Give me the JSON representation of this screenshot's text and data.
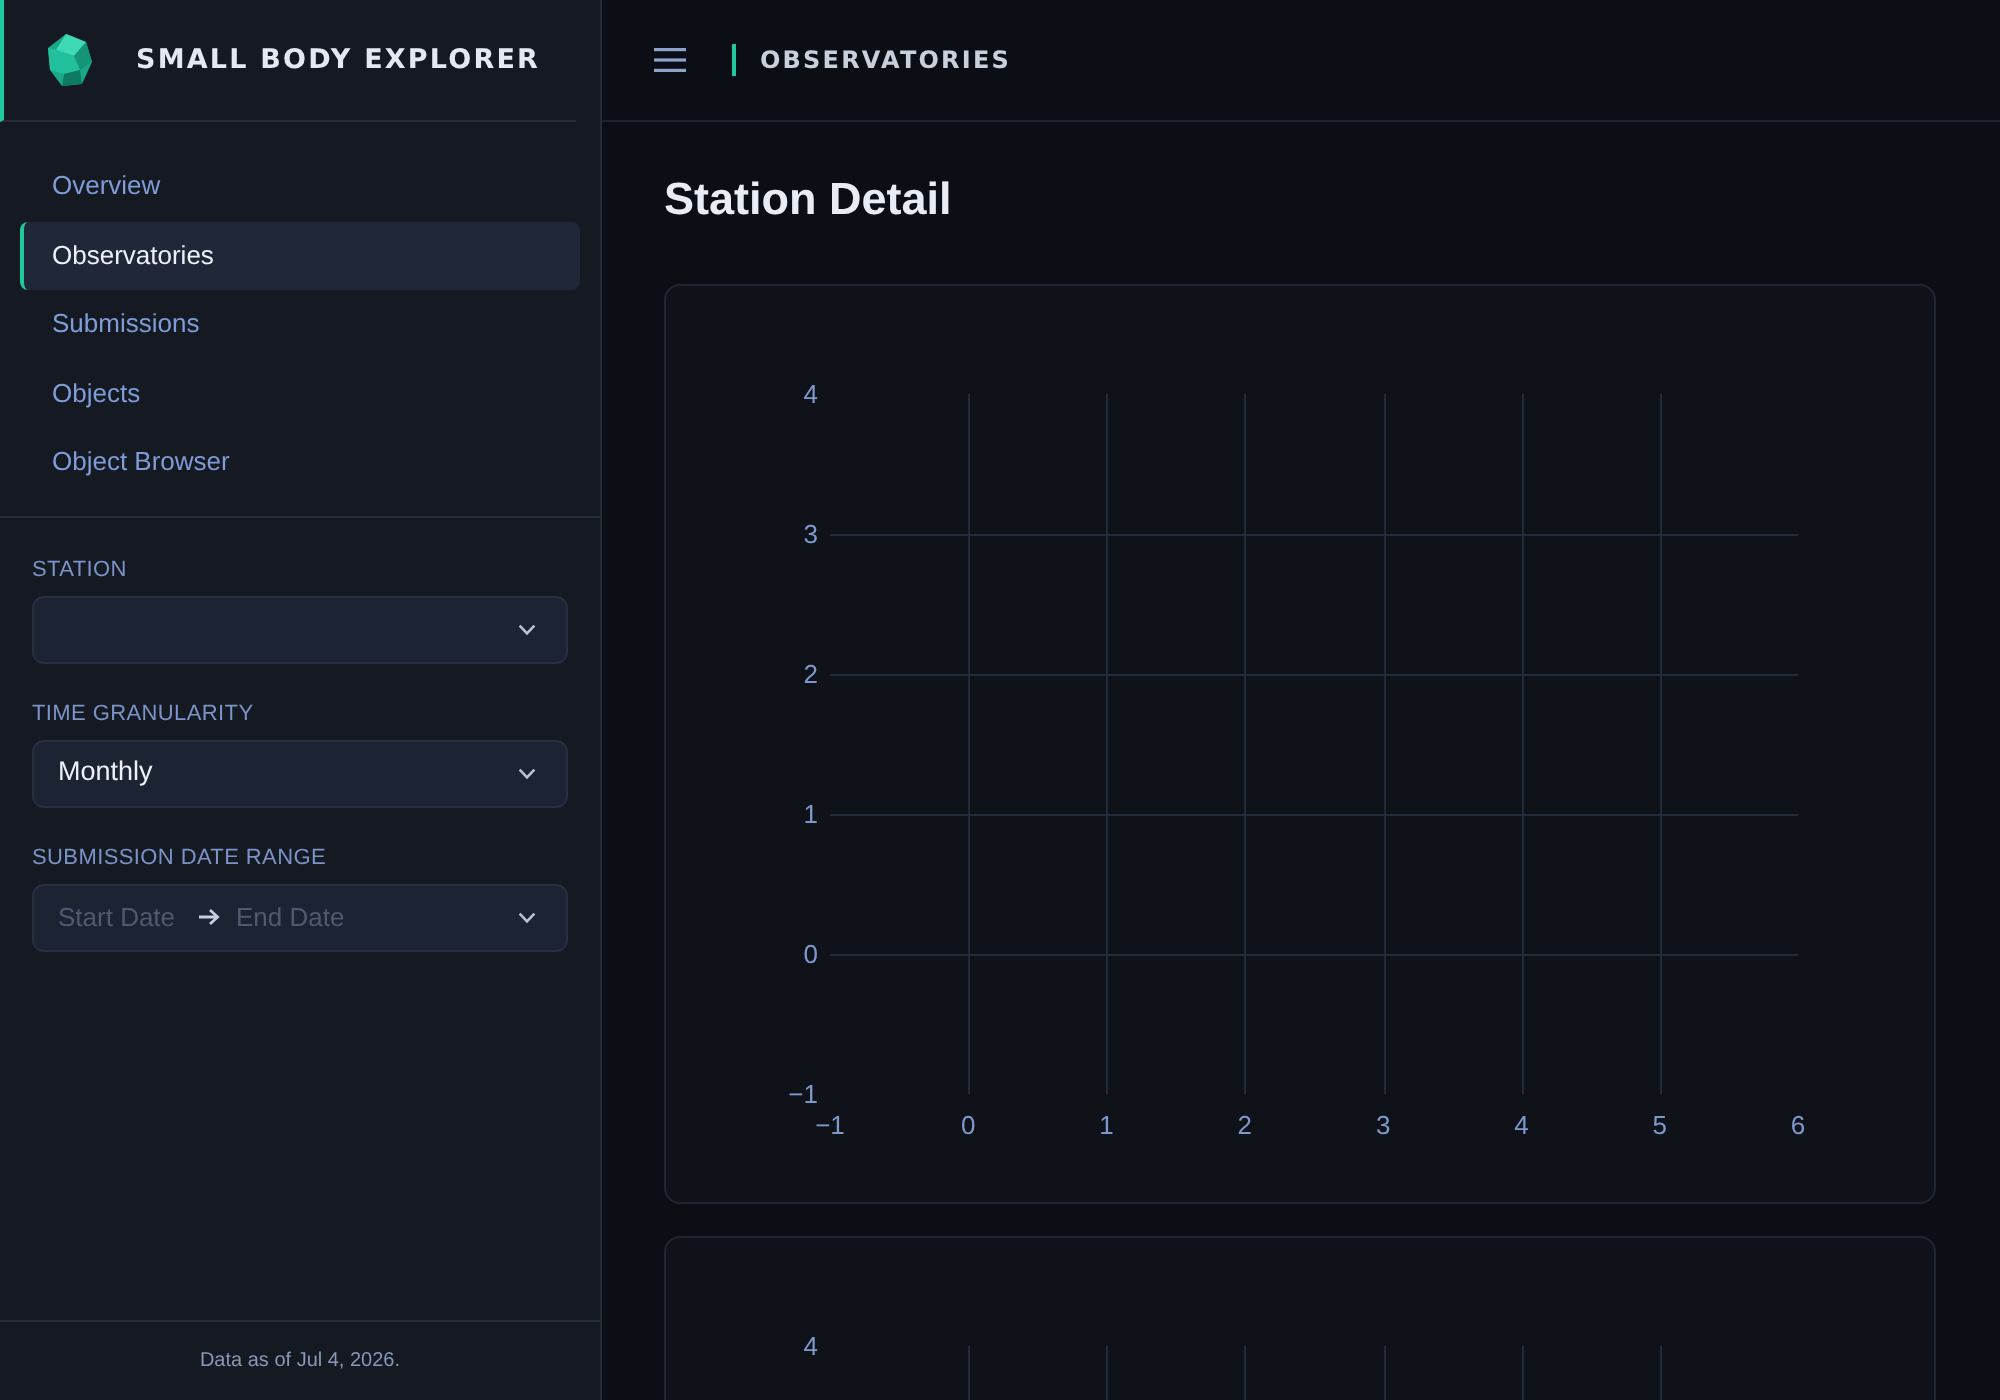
{
  "sidebar": {
    "brand": {
      "title": "SMALL BODY EXPLORER"
    },
    "nav": [
      {
        "label": "Overview",
        "selected": false
      },
      {
        "label": "Observatories",
        "selected": true
      },
      {
        "label": "Submissions",
        "selected": false
      },
      {
        "label": "Objects",
        "selected": false
      },
      {
        "label": "Object Browser",
        "selected": false
      }
    ],
    "filters": [
      {
        "kind": "select",
        "label": "STATION"
      },
      {
        "kind": "select",
        "label": "TIME GRANULARITY",
        "value": "Monthly"
      },
      {
        "kind": "daterange",
        "label": "SUBMISSION DATE RANGE",
        "start": {
          "placeholder": "Start Date"
        },
        "end": {
          "placeholder": "End Date"
        }
      }
    ],
    "footer": "Data as of Jul 4, 2026."
  },
  "topbar": {
    "title": "OBSERVATORIES"
  },
  "main": {
    "heading": "Station Detail",
    "charts": [
      {
        "kind": "plot",
        "chart_data": {
          "type": "scatter",
          "grid": true,
          "xlim": [
            -1,
            6
          ],
          "ylim": [
            -1,
            4
          ],
          "xticks": [
            {
              "value": -1,
              "label": "−1"
            },
            0,
            1,
            2,
            3,
            4,
            5,
            6
          ],
          "yticks": [
            {
              "value": -1,
              "label": "−1"
            },
            0,
            1,
            2,
            3,
            4
          ]
        }
      },
      {
        "kind": "clipped",
        "top_tick_label": "4"
      }
    ]
  }
}
